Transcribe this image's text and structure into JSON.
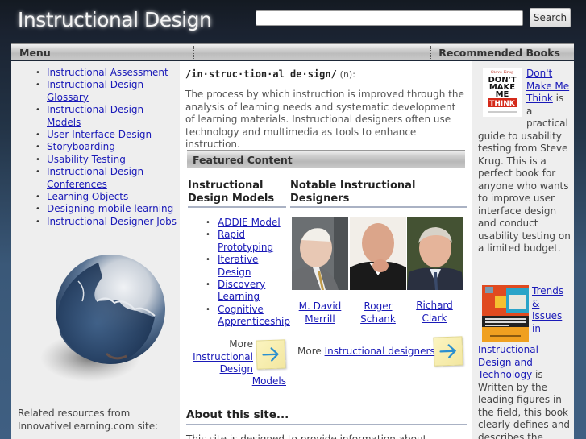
{
  "header": {
    "site_title": "Instructional Design",
    "search": {
      "value": "",
      "placeholder": "",
      "button_label": "Search"
    }
  },
  "menubar": {
    "menu_label": "Menu",
    "books_label": "Recommended Books"
  },
  "sidebar": {
    "items": [
      {
        "label": "Instructional Assessment"
      },
      {
        "label": "Instructional Design Glossary"
      },
      {
        "label": "Instructional Design Models"
      },
      {
        "label": "User Interface Design"
      },
      {
        "label": "Storyboarding"
      },
      {
        "label": "Usability Testing"
      },
      {
        "label": "Instructional Design Conferences"
      },
      {
        "label": "Learning Objects"
      },
      {
        "label": "Designing mobile learning"
      },
      {
        "label": "Instructional Designer Jobs"
      }
    ],
    "image_name": "puzzle-globe",
    "related_text": "Related resources from InnovativeLearning.com site:"
  },
  "main": {
    "pronunciation": "/in·struc·tion·al de·sign/",
    "part_of_speech": "(n):",
    "definition": "The process by which instruction is improved through the analysis of learning needs and systematic development of learning materials. Instructional designers often use technology and multimedia as tools to enhance instruction.",
    "featured_title": "Featured Content",
    "models": {
      "heading": "Instructional Design Models",
      "items": [
        {
          "label": "ADDIE Model"
        },
        {
          "label": "Rapid Prototyping"
        },
        {
          "label": "Iterative Design"
        },
        {
          "label": "Discovery Learning"
        },
        {
          "label": "Cognitive Apprenticeship"
        }
      ],
      "more_prefix": "More",
      "more_link": "Instructional Design",
      "more_link_last": "Models"
    },
    "designers": {
      "heading": "Notable Instructional Designers",
      "people": [
        {
          "name": "M. David Merrill"
        },
        {
          "name": "Roger Schank"
        },
        {
          "name": "Richard Clark"
        }
      ],
      "more_prefix": "More",
      "more_link": "Instructional designers"
    },
    "about": {
      "heading": "About this site...",
      "text": "This site is designed to provide information about"
    }
  },
  "books": [
    {
      "link": "Don't Make Me Think",
      "text": " is a practical guide to usability testing from Steve Krug. This is a perfect book for anyone who wants to improve user interface design and conduct usability testing on a limited budget.",
      "cover": {
        "author": "Steve Krug",
        "line1": "DON'T",
        "line2": "MAKE",
        "line3": "ME",
        "line4": "THINK"
      }
    },
    {
      "link": "Trends & Issues in Instructional Design and Technology ",
      "text": "is Written by the leading figures in the field, this book clearly defines and describes the"
    }
  ],
  "colors": {
    "link": "#1a1ab8",
    "panel": "#eeeeee",
    "heading_rule": "#aab2c4",
    "accent_arrow": "#2a8fd0"
  }
}
